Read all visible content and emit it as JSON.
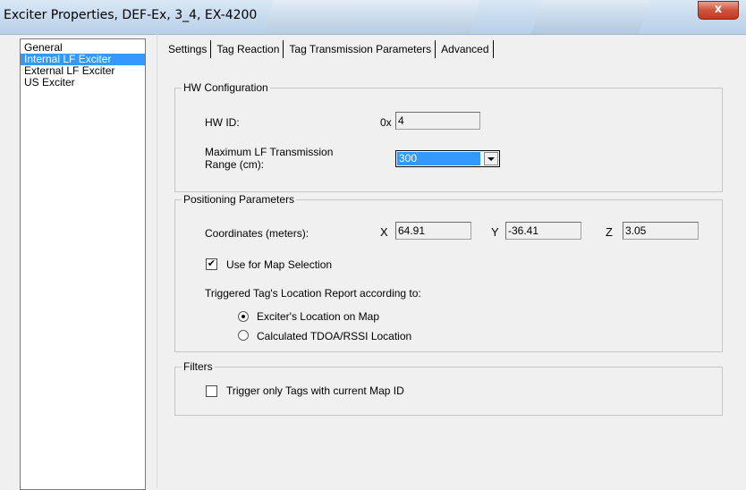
{
  "window": {
    "title": "Exciter Properties, DEF-Ex, 3_4, EX-4200",
    "close_label": "x"
  },
  "sidebar": {
    "items": [
      {
        "label": "General",
        "selected": false
      },
      {
        "label": "Internal LF Exciter",
        "selected": true
      },
      {
        "label": "External LF Exciter",
        "selected": false
      },
      {
        "label": "US Exciter",
        "selected": false
      }
    ]
  },
  "tabs": [
    {
      "label": "Settings",
      "active": true
    },
    {
      "label": "Tag Reaction",
      "active": false
    },
    {
      "label": "Tag Transmission Parameters",
      "active": false
    },
    {
      "label": "Advanced",
      "active": false
    }
  ],
  "hw": {
    "legend": "HW Configuration",
    "hw_id_label": "HW ID:",
    "hw_id_prefix": "0x",
    "hw_id_value": "4",
    "range_label": "Maximum LF Transmission Range (cm):",
    "range_label_line1": "Maximum LF Transmission",
    "range_label_line2": "Range (cm):",
    "range_value": "300"
  },
  "positioning": {
    "legend": "Positioning Parameters",
    "coords_label": "Coordinates (meters):",
    "x_label": "X",
    "x_value": "64.91",
    "y_label": "Y",
    "y_value": "-36.41",
    "z_label": "Z",
    "z_value": "3.05",
    "use_map_label": "Use for Map Selection",
    "use_map_checked": true,
    "report_label": "Triggered Tag's Location Report according to:",
    "radio_options": [
      {
        "label": "Exciter's Location on Map",
        "checked": true
      },
      {
        "label": "Calculated TDOA/RSSI Location",
        "checked": false
      }
    ]
  },
  "filters": {
    "legend": "Filters",
    "trigger_label": "Trigger only Tags with current Map ID",
    "trigger_checked": false
  }
}
